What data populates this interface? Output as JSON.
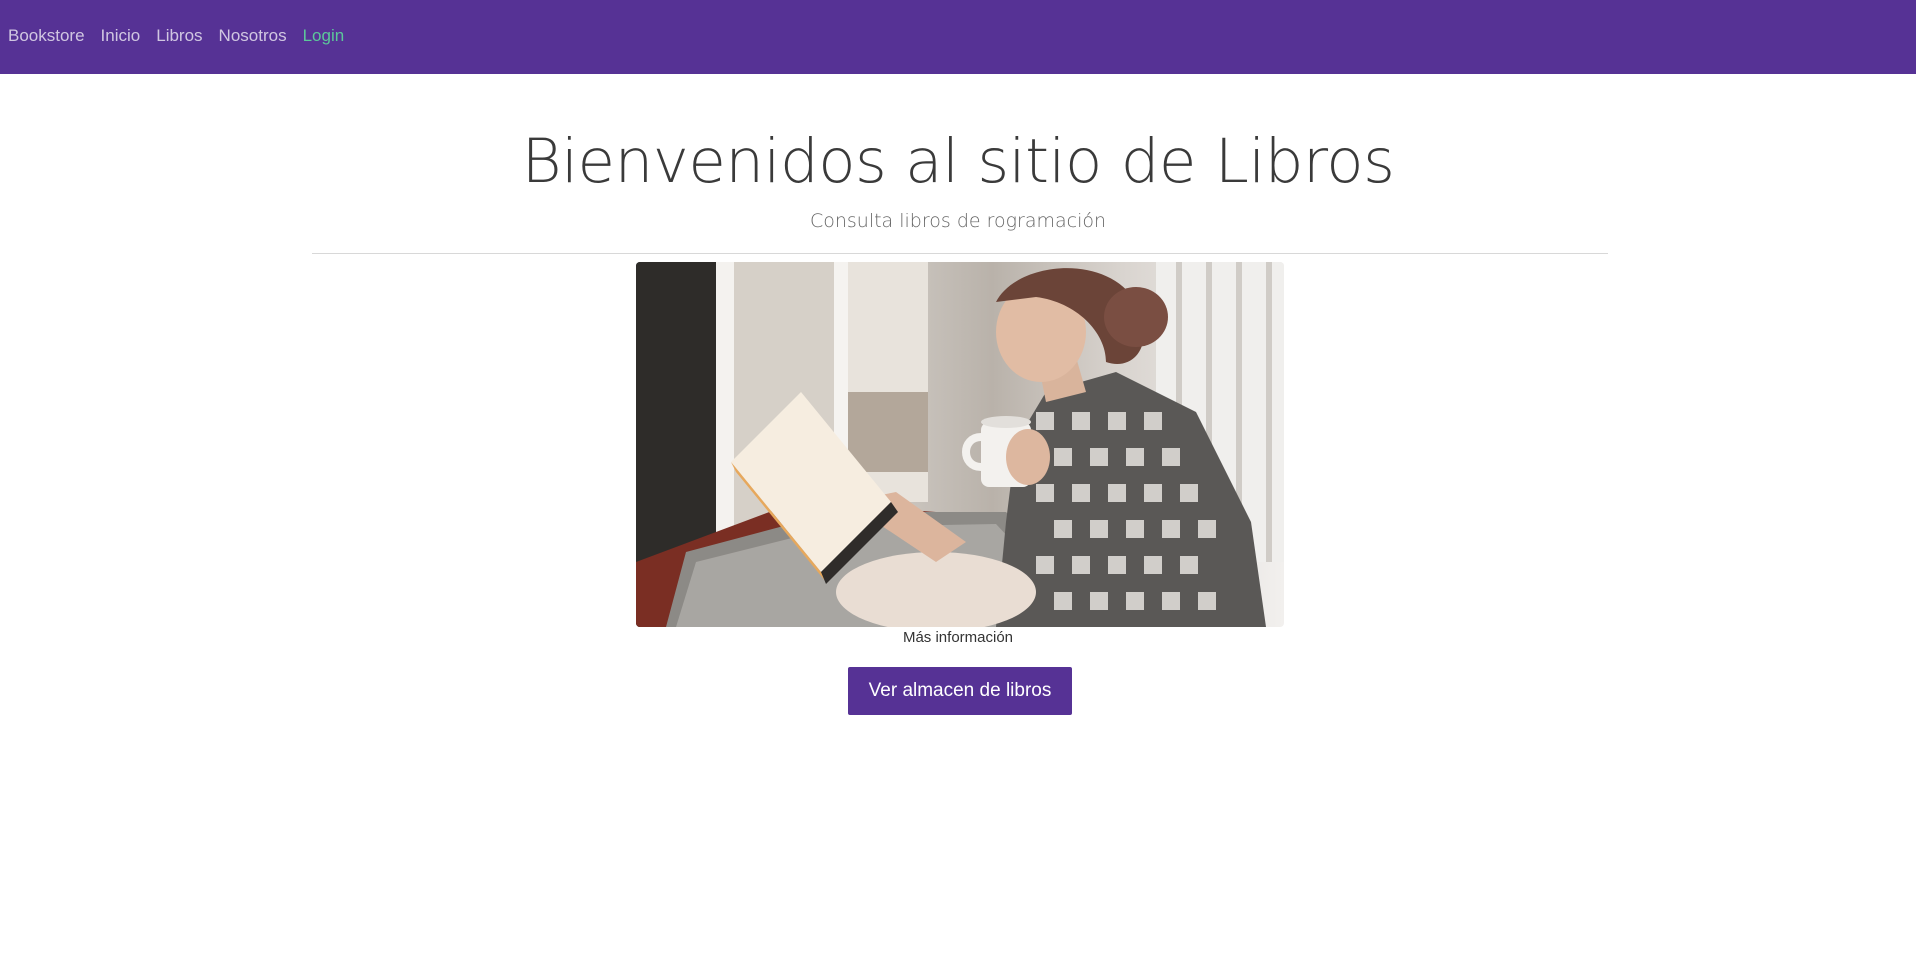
{
  "navbar": {
    "brand": "Bookstore",
    "items": [
      {
        "label": "Inicio"
      },
      {
        "label": "Libros"
      },
      {
        "label": "Nosotros"
      }
    ],
    "login": "Login",
    "background_color": "#563295",
    "login_color": "#5cc79a"
  },
  "hero": {
    "title": "Bienvenidos al sitio de Libros",
    "subtitle": "Consulta libros de rogramación"
  },
  "image": {
    "alt_icon": "photo-woman-reading-book"
  },
  "links": {
    "more_info": "Más información"
  },
  "cta": {
    "label": "Ver almacen de libros",
    "color": "#563295"
  }
}
